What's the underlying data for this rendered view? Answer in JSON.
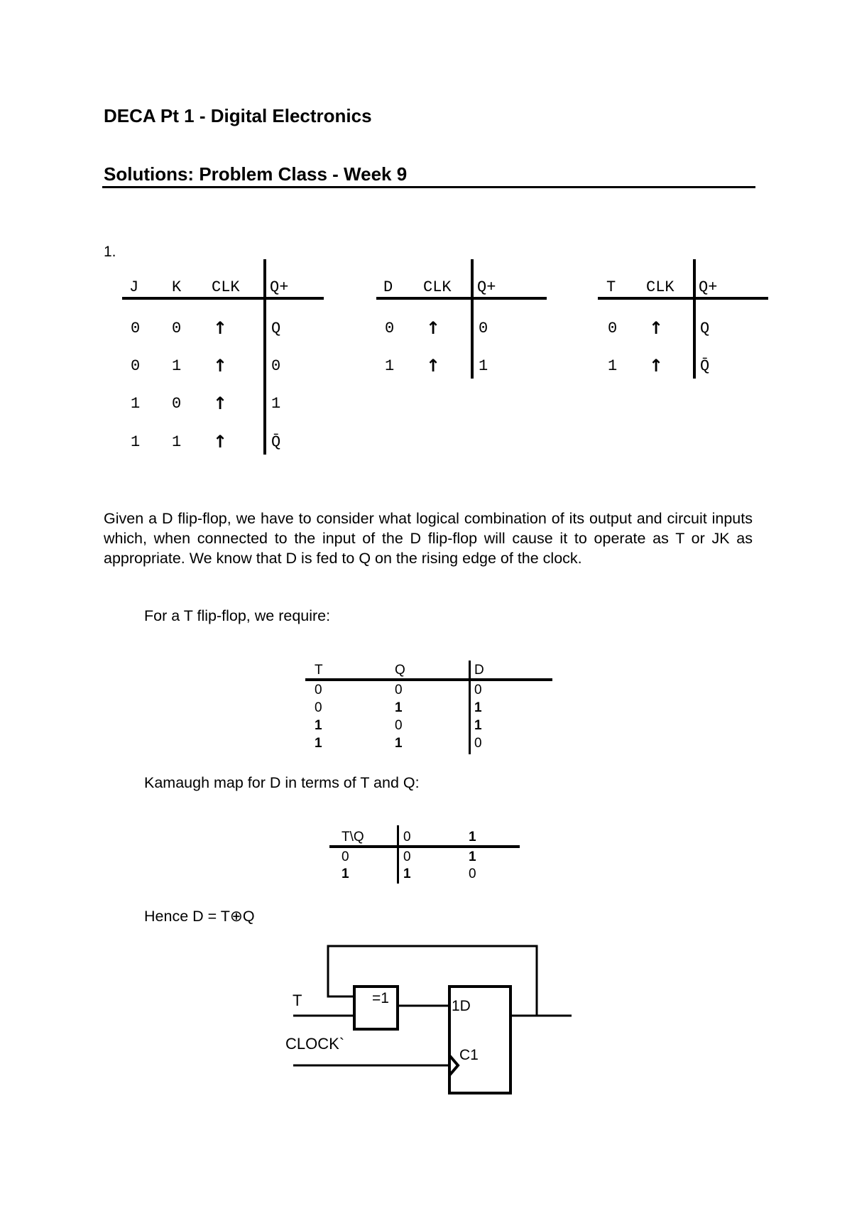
{
  "title": "DECA Pt 1 - Digital Electronics",
  "subtitle": "Solutions: Problem Class - Week 9",
  "question_number": "1.",
  "jk_table": {
    "headers": [
      "J",
      "K",
      "CLK",
      "Q+"
    ],
    "rows": [
      [
        "0",
        "0",
        "↑",
        "Q"
      ],
      [
        "0",
        "1",
        "↑",
        "0"
      ],
      [
        "1",
        "0",
        "↑",
        "1"
      ],
      [
        "1",
        "1",
        "↑",
        "Q̄"
      ]
    ]
  },
  "d_table": {
    "headers": [
      "D",
      "CLK",
      "Q+"
    ],
    "rows": [
      [
        "0",
        "↑",
        "0"
      ],
      [
        "1",
        "↑",
        "1"
      ]
    ]
  },
  "t_table": {
    "headers": [
      "T",
      "CLK",
      "Q+"
    ],
    "rows": [
      [
        "0",
        "↑",
        "Q"
      ],
      [
        "1",
        "↑",
        "Q̄"
      ]
    ]
  },
  "paragraph": "Given a D flip-flop, we have to consider what logical combination of its output and circuit inputs which, when connected to the input of the D flip-flop will cause it to operate as T or JK as appropriate. We know that D is fed to Q on the rising edge of the clock.",
  "t_require_text": "For a T flip-flop, we require:",
  "tqd_table": {
    "headers": [
      "T",
      "Q",
      "D"
    ],
    "rows": [
      [
        "0",
        "0",
        "0"
      ],
      [
        "0",
        "1",
        "1"
      ],
      [
        "1",
        "0",
        "1"
      ],
      [
        "1",
        "1",
        "0"
      ]
    ]
  },
  "kmap_text": "Kamaugh map for D in terms of T and Q:",
  "kmap": {
    "corner": "T\\Q",
    "cols": [
      "0",
      "1"
    ],
    "rows": [
      {
        "label": "0",
        "values": [
          "0",
          "1"
        ]
      },
      {
        "label": "1",
        "values": [
          "1",
          "0"
        ]
      }
    ]
  },
  "hence_text": "Hence D = T⊕Q",
  "circuit": {
    "input_t": "T",
    "input_clock": "CLOCK`",
    "xor_label": "=1",
    "ff_d_label": "1D",
    "ff_c_label": "C1"
  }
}
